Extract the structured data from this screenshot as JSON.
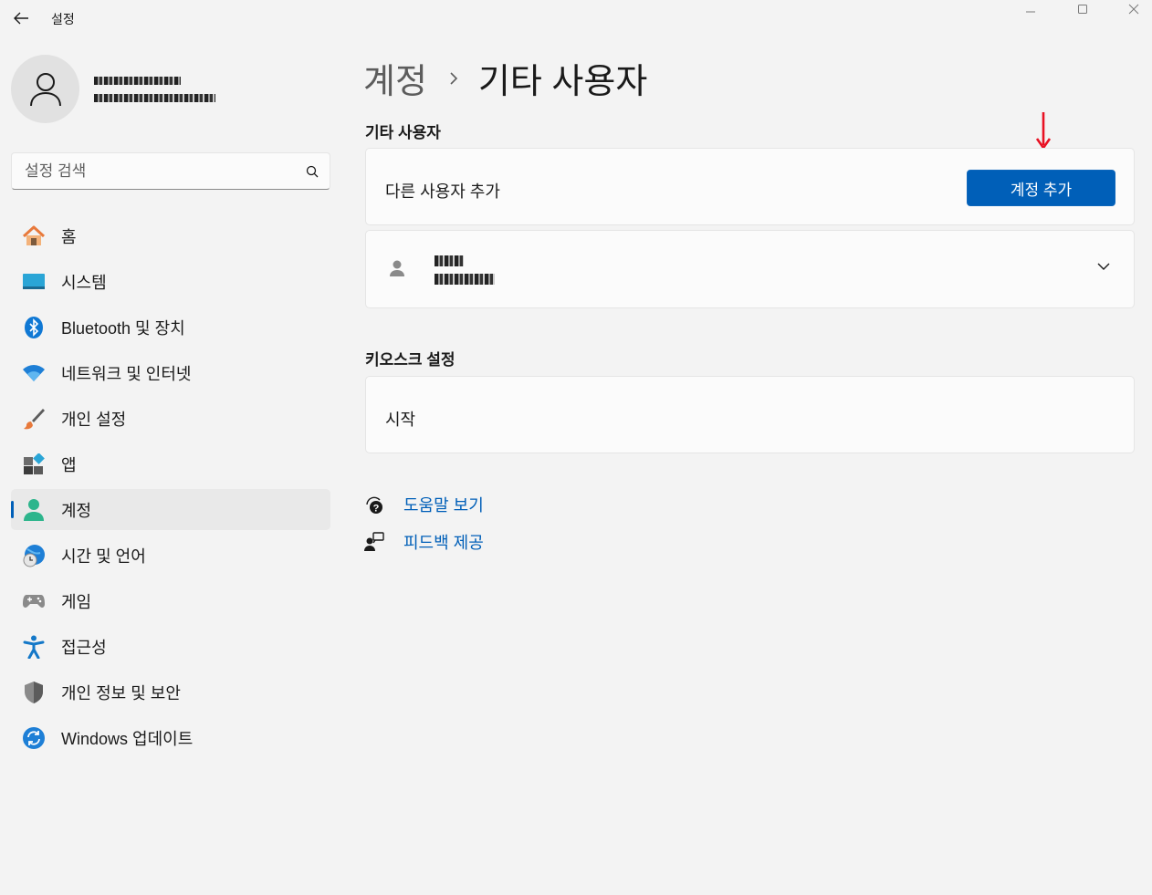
{
  "window": {
    "title": "설정",
    "controls": [
      "minimize-icon",
      "maximize-icon",
      "close-icon"
    ]
  },
  "profile": {
    "name": "",
    "email": ""
  },
  "search": {
    "placeholder": "설정 검색"
  },
  "sidebar": {
    "items": [
      {
        "label": "홈",
        "icon": "home-icon"
      },
      {
        "label": "시스템",
        "icon": "system-icon"
      },
      {
        "label": "Bluetooth 및 장치",
        "icon": "bluetooth-icon"
      },
      {
        "label": "네트워크 및 인터넷",
        "icon": "wifi-icon"
      },
      {
        "label": "개인 설정",
        "icon": "brush-icon"
      },
      {
        "label": "앱",
        "icon": "apps-icon"
      },
      {
        "label": "계정",
        "icon": "account-icon",
        "active": true
      },
      {
        "label": "시간 및 언어",
        "icon": "clock-globe-icon"
      },
      {
        "label": "게임",
        "icon": "gamepad-icon"
      },
      {
        "label": "접근성",
        "icon": "accessibility-icon"
      },
      {
        "label": "개인 정보 및 보안",
        "icon": "shield-icon"
      },
      {
        "label": "Windows 업데이트",
        "icon": "update-icon"
      }
    ]
  },
  "breadcrumb": {
    "parent": "계정",
    "current": "기타 사용자"
  },
  "other_users": {
    "section_title": "기타 사용자",
    "add_label": "다른 사용자 추가",
    "add_button": "계정 추가"
  },
  "kiosk": {
    "section_title": "키오스크 설정",
    "start_label": "시작"
  },
  "links": {
    "help": "도움말 보기",
    "feedback": "피드백 제공"
  },
  "colors": {
    "accent": "#005fb8",
    "background": "#f3f3f3",
    "card": "#fbfbfb",
    "annotation_arrow": "#e81123"
  }
}
